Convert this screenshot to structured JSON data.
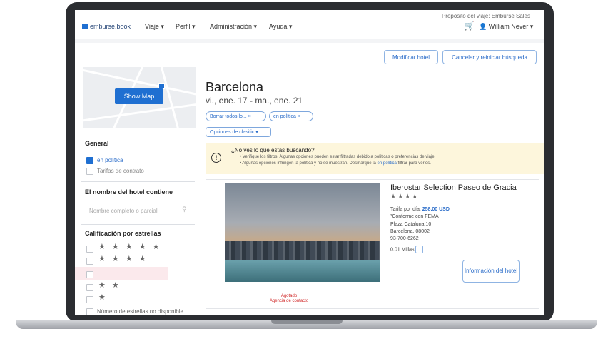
{
  "app": {
    "logo_text": "emburse.book"
  },
  "nav": {
    "items": [
      "Viaje ▾",
      "Perfil ▾",
      "Administración ▾",
      "Ayuda ▾"
    ],
    "trip_purpose": "Propósito del viaje: Emburse Sales",
    "user": "William Never ▾"
  },
  "actions": {
    "modify": "Modificar hotel",
    "cancel": "Cancelar y reiniciar búsqueda"
  },
  "map": {
    "show_map": "Show Map"
  },
  "sidebar": {
    "general_title": "General",
    "in_policy": "en política",
    "contract": "Tarifas de contrato",
    "name_title": "El nombre del hotel contiene",
    "name_placeholder": "Nombre completo o parcial",
    "rating_title": "Calificación por estrellas",
    "stars": [
      "★ ★ ★ ★ ★",
      "★ ★ ★ ★",
      "★ ★ ★",
      "★ ★",
      "★"
    ],
    "no_rating": "Número de estrellas no disponible"
  },
  "main": {
    "city": "Barcelona",
    "dates": "vi., ene. 17  -  ma., ene. 21",
    "chips": [
      "Borrar todos lo...  ×",
      "en política  ×"
    ],
    "sort": "Opciones de clasific ▾"
  },
  "alert": {
    "title": "¿No ves lo que estás buscando?",
    "line1": "• Verifique los filtros. Algunas opciones pueden estar filtradas debido a políticas o preferencias de viaje.",
    "line2_pre": "• Algunas opciones infringen la política y no se muestran. Desmarque la ",
    "line2_link": "en política",
    "line2_post": " filtrar para verlos."
  },
  "hotel": {
    "name": "Iberostar Selection Paseo de Gracia",
    "stars": "★★★★",
    "rate_label": "Tarifa por día:",
    "rate_value": "258.00 USD",
    "fema": "²Conforme con FEMA",
    "address1": "Plaza Cataluna 10",
    "address2": "Barcelona, 08002",
    "phone": "93-700-6262",
    "distance": "0.01 Millas",
    "info_button": "Información del hotel",
    "sold_out": "Agotado",
    "agency": "Agencia de contacto"
  },
  "colors": {
    "accent": "#1f6fd1",
    "alert_bg": "#fdf6dc",
    "sold_out": "#d12b2b"
  }
}
